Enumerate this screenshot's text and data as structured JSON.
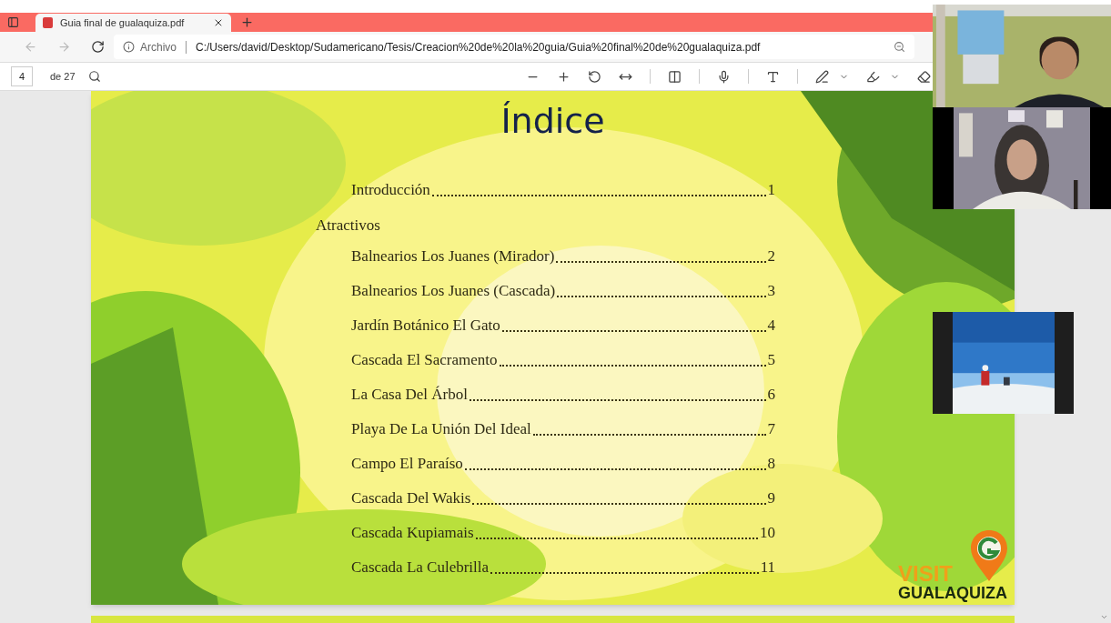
{
  "browser": {
    "tabs": [
      {
        "title": "Guia final de gualaquiza.pdf",
        "selected": true
      }
    ],
    "address": {
      "scheme_label": "Archivo",
      "url": "C:/Users/david/Desktop/Sudamericano/Tesis/Creacion%20de%20la%20guia/Guia%20final%20de%20gualaquiza.pdf"
    }
  },
  "pdf_toolbar": {
    "page": "4",
    "page_count": "de 27"
  },
  "document": {
    "title": "Índice",
    "entries": [
      {
        "kind": "entry",
        "label": "Introducción",
        "page": "1"
      },
      {
        "kind": "heading",
        "label": "Atractivos"
      },
      {
        "kind": "entry",
        "label": "Balnearios Los Juanes (Mirador)",
        "page": "2"
      },
      {
        "kind": "entry",
        "label": "Balnearios Los Juanes (Cascada)",
        "page": "3"
      },
      {
        "kind": "entry",
        "label": "Jardín Botánico El Gato",
        "page": "4"
      },
      {
        "kind": "entry",
        "label": "Cascada El Sacramento",
        "page": "5"
      },
      {
        "kind": "entry",
        "label": "La Casa Del Árbol",
        "page": "6"
      },
      {
        "kind": "entry",
        "label": "Playa De La Unión Del Ideal",
        "page": "7"
      },
      {
        "kind": "entry",
        "label": "Campo El Paraíso",
        "page": "8"
      },
      {
        "kind": "entry",
        "label": "Cascada Del Wakis",
        "page": "9"
      },
      {
        "kind": "entry",
        "label": "Cascada Kupiamais",
        "page": "10"
      },
      {
        "kind": "entry",
        "label": "Cascada La Culebrilla",
        "page": "11"
      }
    ],
    "logo": {
      "line_1": "VISIT",
      "line_2": "GUALAQUIZA"
    }
  }
}
